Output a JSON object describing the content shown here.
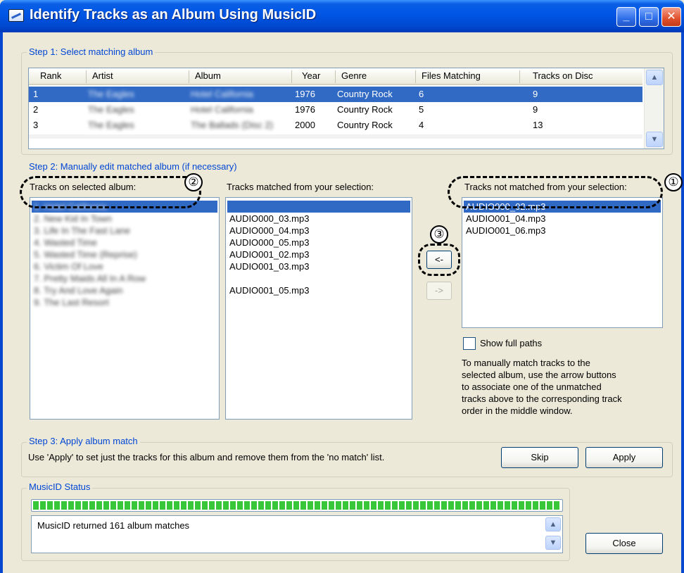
{
  "window": {
    "title": "Identify Tracks as an Album Using MusicID",
    "minimize_glyph": "_",
    "maximize_glyph": "□",
    "close_glyph": "✕"
  },
  "step1": {
    "legend": "Step 1: Select matching album",
    "columns": [
      "Rank",
      "Artist",
      "Album",
      "Year",
      "Genre",
      "Files Matching",
      "Tracks on Disc"
    ],
    "rows": [
      {
        "rank": "1",
        "artist": "The Eagles",
        "album": "Hotel California",
        "year": "1976",
        "genre": "Country Rock",
        "files": "6",
        "tracks": "9",
        "selected": true
      },
      {
        "rank": "2",
        "artist": "The Eagles",
        "album": "Hotel California",
        "year": "1976",
        "genre": "Country Rock",
        "files": "5",
        "tracks": "9",
        "selected": false
      },
      {
        "rank": "3",
        "artist": "The Eagles",
        "album": "The Ballads (Disc 2)",
        "year": "2000",
        "genre": "Country Rock",
        "files": "4",
        "tracks": "13",
        "selected": false
      }
    ]
  },
  "step2": {
    "legend": "Step 2: Manually edit matched album (if necessary)",
    "selected_album_label": "Tracks on selected album:",
    "matched_label": "Tracks matched from your selection:",
    "not_matched_label": "Tracks not matched from your selection:",
    "album_tracks": [
      "1. Hotel California",
      "2. New Kid In Town",
      "3. Life In The Fast Lane",
      "4. Wasted Time",
      "5. Wasted Time (Reprise)",
      "6. Victim Of Love",
      "7. Pretty Maids All In A Row",
      "8. Try And Love Again",
      "9. The Last Resort"
    ],
    "matched_tracks": [
      "",
      "AUDIO000_03.mp3",
      "AUDIO000_04.mp3",
      "AUDIO000_05.mp3",
      "AUDIO001_02.mp3",
      "AUDIO001_03.mp3",
      "",
      "AUDIO001_05.mp3"
    ],
    "unmatched_tracks": [
      "AUDIO000_02.mp3",
      "AUDIO001_04.mp3",
      "AUDIO001_06.mp3"
    ],
    "move_left_label": "<-",
    "move_right_label": "->",
    "show_full_paths_label": "Show full paths",
    "help_text_lines": [
      "To manually match tracks to the",
      "selected album, use the arrow buttons",
      "to associate one of the unmatched",
      "tracks above to the corresponding track",
      "order in the middle window."
    ]
  },
  "step3": {
    "legend": "Step 3: Apply album match",
    "description": "Use 'Apply' to set just the tracks for this album and remove them from the 'no match' list.",
    "skip_label": "Skip",
    "apply_label": "Apply"
  },
  "status": {
    "legend": "MusicID Status",
    "progress": 1.0,
    "message": "MusicID returned 161 album matches",
    "close_label": "Close"
  },
  "annotations": {
    "marker_1": "①",
    "marker_2": "②",
    "marker_3": "③"
  },
  "icons": {
    "scroll_up": "up-arrow-icon",
    "scroll_down": "down-arrow-icon"
  }
}
